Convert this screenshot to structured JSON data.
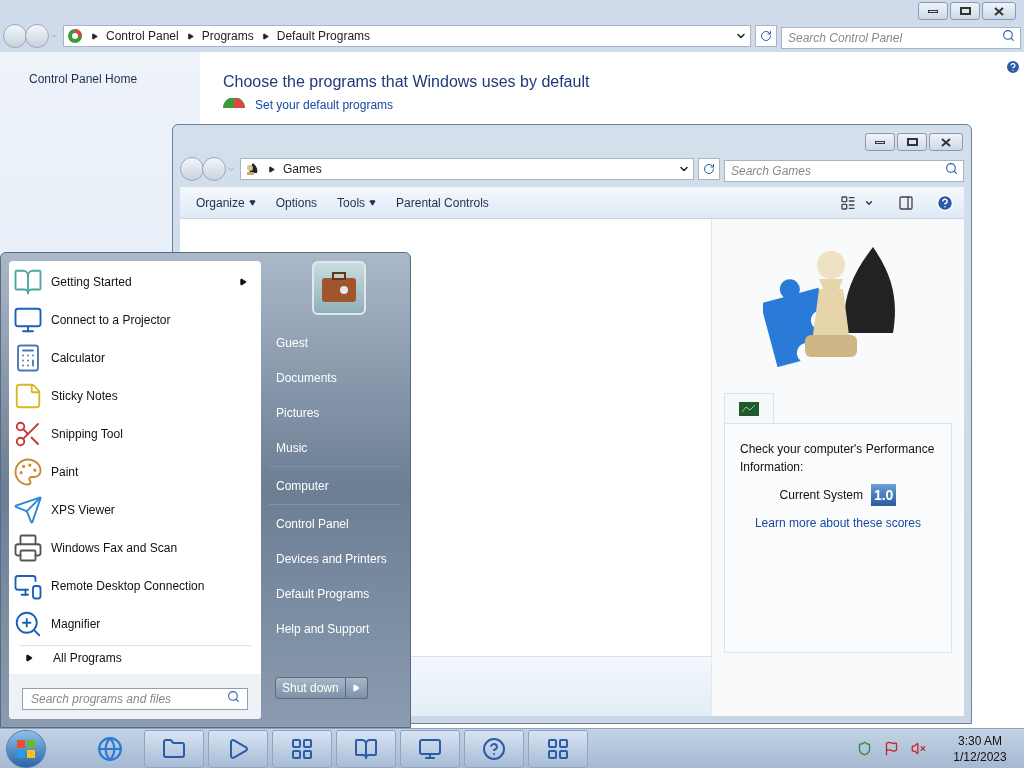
{
  "control_panel": {
    "breadcrumb": [
      "Control Panel",
      "Programs",
      "Default Programs"
    ],
    "search": {
      "placeholder": "Search Control Panel"
    },
    "sidebar": {
      "items": [
        "Control Panel Home"
      ]
    },
    "heading": "Choose the programs that Windows uses by default",
    "link": "Set your default programs"
  },
  "games_window": {
    "breadcrumb": [
      "Games"
    ],
    "search": {
      "placeholder": "Search Games"
    },
    "toolbar": [
      {
        "label": "Organize",
        "dropdown": true
      },
      {
        "label": "Options",
        "dropdown": false
      },
      {
        "label": "Tools",
        "dropdown": true
      },
      {
        "label": "Parental Controls",
        "dropdown": false
      }
    ],
    "performance": {
      "text": "Check your computer's Performance Information:",
      "label": "Current System",
      "score": "1.0",
      "link": "Learn more about these scores"
    }
  },
  "start_menu": {
    "programs": [
      {
        "label": "Getting Started",
        "submenu": true
      },
      {
        "label": "Connect to a Projector",
        "submenu": false
      },
      {
        "label": "Calculator",
        "submenu": false
      },
      {
        "label": "Sticky Notes",
        "submenu": false
      },
      {
        "label": "Snipping Tool",
        "submenu": false
      },
      {
        "label": "Paint",
        "submenu": false
      },
      {
        "label": "XPS Viewer",
        "submenu": false
      },
      {
        "label": "Windows Fax and Scan",
        "submenu": false
      },
      {
        "label": "Remote Desktop Connection",
        "submenu": false
      },
      {
        "label": "Magnifier",
        "submenu": false
      }
    ],
    "all_programs": "All Programs",
    "search": {
      "placeholder": "Search programs and files"
    },
    "places": [
      {
        "label": "Guest",
        "separator_before": false
      },
      {
        "label": "Documents",
        "separator_before": false
      },
      {
        "label": "Pictures",
        "separator_before": false
      },
      {
        "label": "Music",
        "separator_before": false
      },
      {
        "label": "Computer",
        "separator_before": true
      },
      {
        "label": "Control Panel",
        "separator_before": true
      },
      {
        "label": "Devices and Printers",
        "separator_before": false
      },
      {
        "label": "Default Programs",
        "separator_before": false
      },
      {
        "label": "Help and Support",
        "separator_before": false
      }
    ],
    "shutdown": "Shut down"
  },
  "taskbar": {
    "clock": {
      "time": "3:30 AM",
      "date": "1/12/2023"
    }
  }
}
